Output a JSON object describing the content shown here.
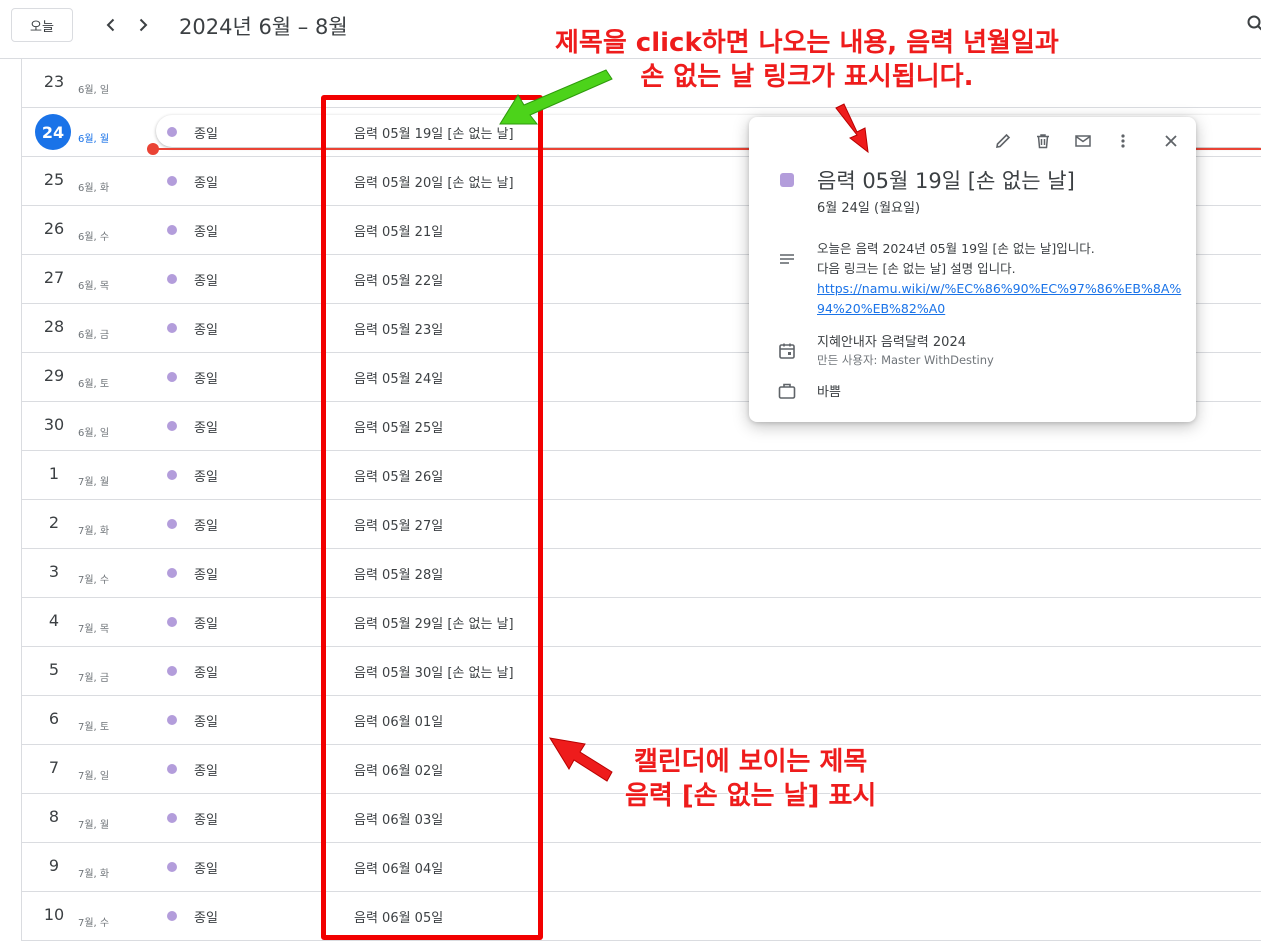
{
  "toolbar": {
    "today_label": "오늘",
    "range_title": "2024년 6월 – 8월"
  },
  "rows": [
    {
      "day": "23",
      "label": "6월, 일",
      "allday": "",
      "event": ""
    },
    {
      "day": "24",
      "label": "6월, 월",
      "allday": "종일",
      "event": "음력 05월 19일 [손 없는 날]",
      "today": true
    },
    {
      "day": "25",
      "label": "6월, 화",
      "allday": "종일",
      "event": "음력 05월 20일 [손 없는 날]"
    },
    {
      "day": "26",
      "label": "6월, 수",
      "allday": "종일",
      "event": "음력 05월 21일"
    },
    {
      "day": "27",
      "label": "6월, 목",
      "allday": "종일",
      "event": "음력 05월 22일"
    },
    {
      "day": "28",
      "label": "6월, 금",
      "allday": "종일",
      "event": "음력 05월 23일"
    },
    {
      "day": "29",
      "label": "6월, 토",
      "allday": "종일",
      "event": "음력 05월 24일"
    },
    {
      "day": "30",
      "label": "6월, 일",
      "allday": "종일",
      "event": "음력 05월 25일"
    },
    {
      "day": "1",
      "label": "7월, 월",
      "allday": "종일",
      "event": "음력 05월 26일"
    },
    {
      "day": "2",
      "label": "7월, 화",
      "allday": "종일",
      "event": "음력 05월 27일"
    },
    {
      "day": "3",
      "label": "7월, 수",
      "allday": "종일",
      "event": "음력 05월 28일"
    },
    {
      "day": "4",
      "label": "7월, 목",
      "allday": "종일",
      "event": "음력 05월 29일 [손 없는 날]"
    },
    {
      "day": "5",
      "label": "7월, 금",
      "allday": "종일",
      "event": "음력 05월 30일 [손 없는 날]"
    },
    {
      "day": "6",
      "label": "7월, 토",
      "allday": "종일",
      "event": "음력 06월 01일"
    },
    {
      "day": "7",
      "label": "7월, 일",
      "allday": "종일",
      "event": "음력 06월 02일"
    },
    {
      "day": "8",
      "label": "7월, 월",
      "allday": "종일",
      "event": "음력 06월 03일"
    },
    {
      "day": "9",
      "label": "7월, 화",
      "allday": "종일",
      "event": "음력 06월 04일"
    },
    {
      "day": "10",
      "label": "7월, 수",
      "allday": "종일",
      "event": "음력 06월 05일"
    }
  ],
  "popup": {
    "title": "음력 05월 19일 [손 없는 날]",
    "date": "6월 24일 (월요일)",
    "desc_line1": "오늘은 음력 2024년 05월 19일 [손 없는 날]입니다.",
    "desc_line2": "다음 링크는 [손 없는 날] 설명 입니다.",
    "link": "https://namu.wiki/w/%EC%86%90%EC%97%86%EB%8A%94%20%EB%82%A0",
    "calendar_name": "지혜안내자 음력달력 2024",
    "creator": "만든 사용자: Master WithDestiny",
    "availability": "바쁨"
  },
  "annotations": {
    "top_line1": "제목을 click하면 나오는 내용, 음력 년월일과",
    "top_line2": "손 없는 날 링크가 표시됩니다.",
    "bottom_line1": "캘린더에 보이는 제목",
    "bottom_line2": "음력 [손 없는 날] 표시"
  },
  "colors": {
    "event_dot": "#b39ddb",
    "today_accent": "#1a73e8",
    "now_line": "#ea4335",
    "annotation_red": "#f20000",
    "annotation_green": "#4cd31a"
  }
}
